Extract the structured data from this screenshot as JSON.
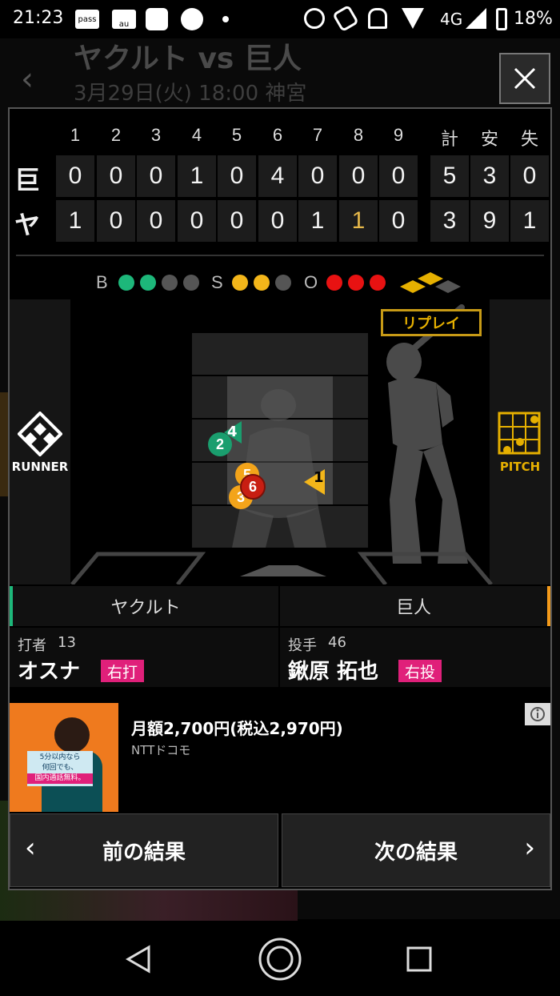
{
  "status_bar": {
    "time": "21:23",
    "left_icons": [
      "pass",
      "au"
    ],
    "network": "4G",
    "battery": "18%"
  },
  "background_page": {
    "title": "ヤクルト vs 巨人",
    "subtitle": "3月29日(火) 18:00 神宮"
  },
  "scoreboard": {
    "innings": [
      "1",
      "2",
      "3",
      "4",
      "5",
      "6",
      "7",
      "8",
      "9"
    ],
    "totals_headers": [
      "計",
      "安",
      "失"
    ],
    "rows": [
      {
        "team": "巨",
        "scores": [
          "0",
          "0",
          "0",
          "1",
          "0",
          "4",
          "0",
          "0",
          "0"
        ],
        "totals": [
          "5",
          "3",
          "0"
        ]
      },
      {
        "team": "ヤ",
        "scores": [
          "1",
          "0",
          "0",
          "0",
          "0",
          "0",
          "1",
          "1",
          "0"
        ],
        "totals": [
          "3",
          "9",
          "1"
        ]
      }
    ]
  },
  "count": {
    "b_label": "B",
    "s_label": "S",
    "o_label": "O",
    "balls": 2,
    "balls_max": 4,
    "strikes": 2,
    "strikes_max": 3,
    "outs": 3,
    "outs_max": 3,
    "colors": {
      "ball": "#1db77a",
      "strike": "#f3b61a",
      "out": "#e81212",
      "off": "#555555"
    }
  },
  "field": {
    "replay_label": "リプレイ",
    "runner_label": "RUNNER",
    "pitch_label": "PITCH",
    "pitches": [
      {
        "num": "1",
        "shape": "triangle",
        "color": "#f3b61a"
      },
      {
        "num": "2",
        "shape": "circle",
        "color": "#1a9e6e"
      },
      {
        "num": "3",
        "shape": "circle",
        "color": "#f3a41a"
      },
      {
        "num": "4",
        "shape": "triangle",
        "color": "#1a9e6e"
      },
      {
        "num": "5",
        "shape": "circle",
        "color": "#f3a41a"
      },
      {
        "num": "6",
        "shape": "circle",
        "color": "#c81e12"
      }
    ]
  },
  "matchup": {
    "home_team": "ヤクルト",
    "away_team": "巨人",
    "batter": {
      "label": "打者",
      "number": "13",
      "name": "オスナ",
      "hand": "右打"
    },
    "pitcher": {
      "label": "投手",
      "number": "46",
      "name": "鍬原 拓也",
      "hand": "右投"
    }
  },
  "ad": {
    "headline": "月額2,700円(税込2,970円)",
    "advertiser": "NTTドコモ",
    "image_text": [
      "5分以内なら",
      "何回でも、",
      "国内通話無料。"
    ]
  },
  "nav": {
    "prev_label": "前の結果",
    "next_label": "次の結果"
  }
}
